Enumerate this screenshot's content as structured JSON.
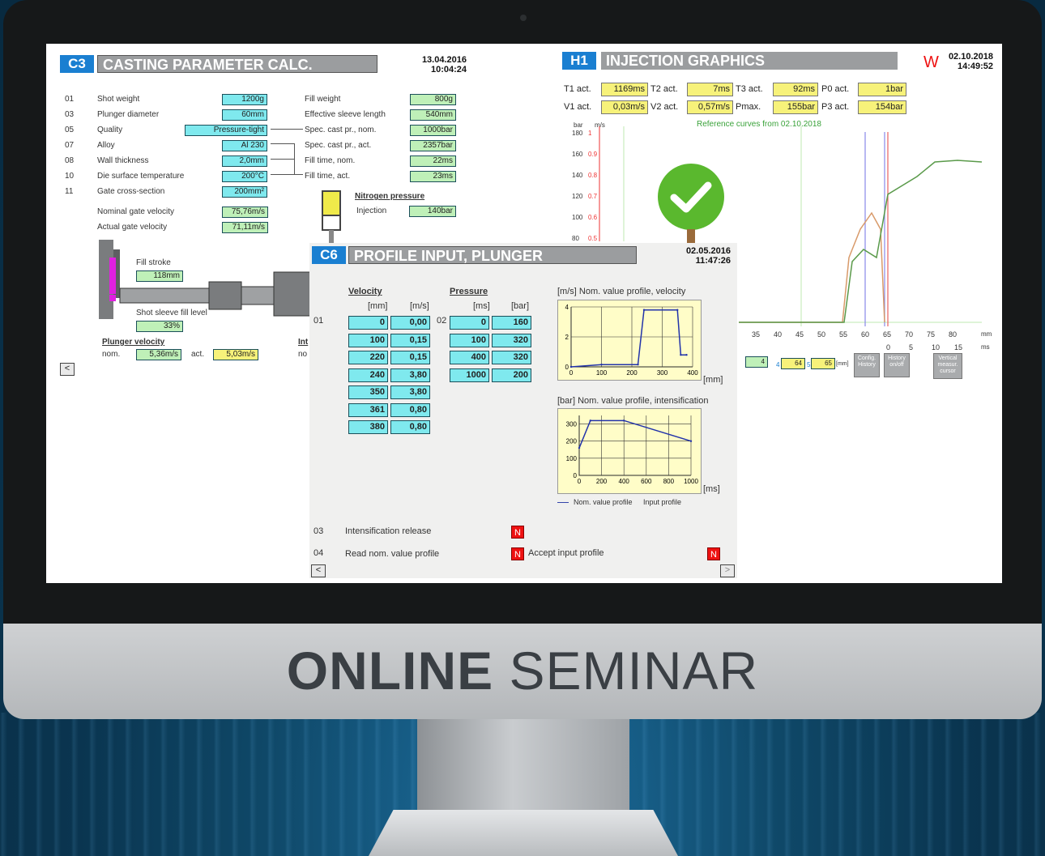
{
  "branding": {
    "bold": "ONLINE",
    "light": "SEMINAR"
  },
  "c3": {
    "tag": "C3",
    "title": "CASTING PARAMETER CALC.",
    "date": "13.04.2016",
    "time": "10:04:24",
    "left_rows": [
      {
        "n": "01",
        "label": "Shot weight",
        "value": "1200g"
      },
      {
        "n": "03",
        "label": "Plunger diameter",
        "value": "60mm"
      },
      {
        "n": "05",
        "label": "Quality",
        "value": "Pressure-tight"
      },
      {
        "n": "07",
        "label": "Alloy",
        "value": "Al 230"
      },
      {
        "n": "08",
        "label": "Wall thickness",
        "value": "2,0mm"
      },
      {
        "n": "10",
        "label": "Die surface temperature",
        "value": "200°C"
      },
      {
        "n": "11",
        "label": "Gate cross-section",
        "value": "200mm²"
      }
    ],
    "right_rows": [
      {
        "label": "Fill weight",
        "value": "800g"
      },
      {
        "label": "Effective sleeve length",
        "value": "540mm"
      },
      {
        "label": "Spec. cast pr., nom.",
        "value": "1000bar"
      },
      {
        "label": "Spec. cast pr., act.",
        "value": "2357bar"
      },
      {
        "label": "Fill time, nom.",
        "value": "22ms"
      },
      {
        "label": "Fill time, act.",
        "value": "23ms"
      }
    ],
    "nominal_gate_velocity_label": "Nominal gate velocity",
    "nominal_gate_velocity": "75,76m/s",
    "actual_gate_velocity_label": "Actual gate velocity",
    "actual_gate_velocity": "71,11m/s",
    "nitrogen_pressure_label": "Nitrogen pressure",
    "injection_label": "Injection",
    "injection_value": "140bar",
    "fill_stroke_label": "Fill stroke",
    "fill_stroke_value": "118mm",
    "shot_sleeve_label": "Shot sleeve fill level",
    "shot_sleeve_value": "33%",
    "plunger_velocity_label": "Plunger velocity",
    "nom_label": "nom.",
    "nom_value": "5,36m/s",
    "act_label": "act.",
    "act_value": "5,03m/s",
    "int_label": "Int",
    "no_label": "no",
    "back_btn": "<"
  },
  "h1": {
    "tag": "H1",
    "title": "INJECTION GRAPHICS",
    "warn": "W",
    "date": "02.10.2018",
    "time": "14:49:52",
    "row1": [
      {
        "label": "T1 act.",
        "value": "1169ms"
      },
      {
        "label": "T2 act.",
        "value": "7ms"
      },
      {
        "label": "T3 act.",
        "value": "92ms"
      },
      {
        "label": "P0 act.",
        "value": "1bar"
      }
    ],
    "row2": [
      {
        "label": "V1 act.",
        "value": "0,03m/s"
      },
      {
        "label": "V2 act.",
        "value": "0,57m/s"
      },
      {
        "label": "Pmax.",
        "value": "155bar"
      },
      {
        "label": "P3 act.",
        "value": "154bar"
      }
    ],
    "reference": "Reference curves from 02.10.2018",
    "unit_bar": "bar",
    "unit_ms": "m/s",
    "y_ticks_bar": [
      "180",
      "160",
      "140",
      "120",
      "100",
      "80"
    ],
    "y_ticks_ms": [
      "1",
      "0.9",
      "0.8",
      "0.7",
      "0.6",
      "0.5"
    ],
    "x_ticks_mm": [
      "35",
      "40",
      "45",
      "50",
      "55",
      "60",
      "65",
      "70",
      "75",
      "80"
    ],
    "x_unit_mm": "mm",
    "x_ticks_ms": [
      "0",
      "5",
      "10",
      "15"
    ],
    "x_unit_ms": "ms",
    "cursor_vals": [
      "4",
      "64",
      "65"
    ],
    "cursor_idx": [
      "4",
      "5"
    ],
    "cursor_unit": "[mm]",
    "btn_config": "Config. History",
    "btn_history": "History on/off",
    "btn_vertical": "Vertical measur. cursor"
  },
  "c6": {
    "tag": "C6",
    "title": "PROFILE INPUT, PLUNGER",
    "date": "02.05.2016",
    "time": "11:47:26",
    "velocity_label": "Velocity",
    "pressure_label": "Pressure",
    "vel_unit1": "[mm]",
    "vel_unit2": "[m/s]",
    "pr_unit1": "[ms]",
    "pr_unit2": "[bar]",
    "row01": "01",
    "row02": "02",
    "velocity_rows": [
      [
        "0",
        "0,00"
      ],
      [
        "100",
        "0,15"
      ],
      [
        "220",
        "0,15"
      ],
      [
        "240",
        "3,80"
      ],
      [
        "350",
        "3,80"
      ],
      [
        "361",
        "0,80"
      ],
      [
        "380",
        "0,80"
      ]
    ],
    "pressure_rows": [
      [
        "0",
        "160"
      ],
      [
        "100",
        "320"
      ],
      [
        "400",
        "320"
      ],
      [
        "1000",
        "200"
      ]
    ],
    "vel_chart_title": "[m/s] Nom. value profile, velocity",
    "vel_chart_x_unit": "[mm]",
    "pr_chart_title": "[bar] Nom. value profile, intensification",
    "pr_chart_x_unit": "[ms]",
    "legend_nom": "Nom. value profile",
    "legend_input": "Input profile",
    "r03": "03",
    "r03_label": "Intensification release",
    "r04": "04",
    "r04_label": "Read nom. value profile",
    "accept_label": "Accept input profile",
    "n_btn": "N",
    "back_btn": "<",
    "fwd_btn": ">"
  },
  "chart_data": [
    {
      "type": "line",
      "title": "[m/s] Nom. value profile, velocity",
      "xlabel": "[mm]",
      "ylabel": "[m/s]",
      "x": [
        0,
        100,
        220,
        240,
        350,
        361,
        380
      ],
      "y": [
        0.0,
        0.15,
        0.15,
        3.8,
        3.8,
        0.8,
        0.8
      ],
      "xlim": [
        0,
        400
      ],
      "ylim": [
        0,
        4
      ],
      "x_ticks": [
        "0",
        "100",
        "200",
        "300",
        "400"
      ],
      "y_ticks": [
        "0",
        "2",
        "4"
      ]
    },
    {
      "type": "line",
      "title": "[bar] Nom. value profile, intensification",
      "xlabel": "[ms]",
      "ylabel": "[bar]",
      "x": [
        0,
        100,
        400,
        1000
      ],
      "y": [
        160,
        320,
        320,
        200
      ],
      "xlim": [
        0,
        1000
      ],
      "ylim": [
        0,
        350
      ],
      "x_ticks": [
        "0",
        "200",
        "400",
        "600",
        "800",
        "1000"
      ],
      "y_ticks": [
        "0",
        "100",
        "200",
        "300"
      ],
      "series": [
        {
          "name": "Nom. value profile"
        },
        {
          "name": "Input profile"
        }
      ]
    }
  ],
  "colors": {
    "accent_blue": "#1a7fd1",
    "field_cyan": "#7fe9ee",
    "field_yellow": "#f7f27a",
    "field_green": "#bff0b8",
    "ok_green": "#5ab82e",
    "warn_red": "#e11111"
  }
}
